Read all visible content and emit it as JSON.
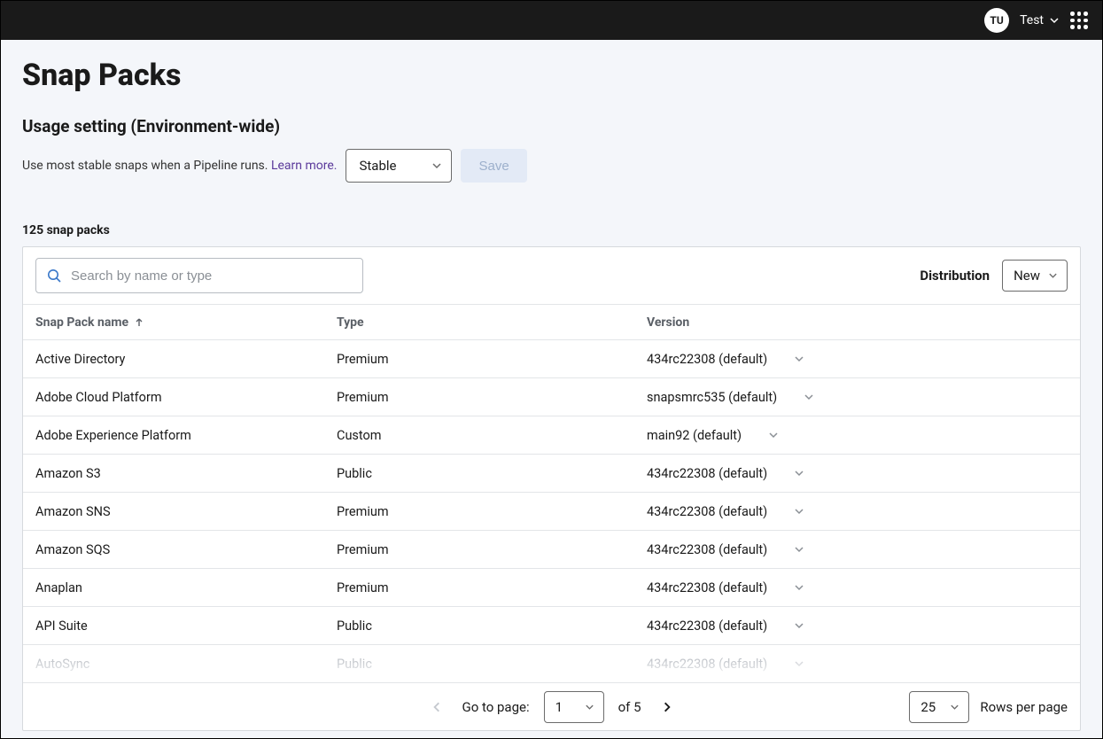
{
  "header": {
    "avatar_initials": "TU",
    "account_label": "Test"
  },
  "page_title": "Snap Packs",
  "usage": {
    "section_title": "Usage setting (Environment-wide)",
    "description": "Use most stable snaps when a Pipeline runs. ",
    "learn_more": "Learn more.",
    "stability_option": "Stable",
    "save_label": "Save"
  },
  "count_label": "125 snap packs",
  "search": {
    "placeholder": "Search by name or type"
  },
  "distribution": {
    "label": "Distribution",
    "selected": "New"
  },
  "columns": {
    "name": "Snap Pack name",
    "type": "Type",
    "version": "Version"
  },
  "rows": [
    {
      "name": "Active Directory",
      "type": "Premium",
      "version": "434rc22308 (default)"
    },
    {
      "name": "Adobe Cloud Platform",
      "type": "Premium",
      "version": "snapsmrc535 (default)"
    },
    {
      "name": "Adobe Experience Platform",
      "type": "Custom",
      "version": "main92 (default)"
    },
    {
      "name": "Amazon S3",
      "type": "Public",
      "version": "434rc22308 (default)"
    },
    {
      "name": "Amazon SNS",
      "type": "Premium",
      "version": "434rc22308 (default)"
    },
    {
      "name": "Amazon SQS",
      "type": "Premium",
      "version": "434rc22308 (default)"
    },
    {
      "name": "Anaplan",
      "type": "Premium",
      "version": "434rc22308 (default)"
    },
    {
      "name": "API Suite",
      "type": "Public",
      "version": "434rc22308 (default)"
    },
    {
      "name": "AutoSync",
      "type": "Public",
      "version": "434rc22308 (default)"
    }
  ],
  "pagination": {
    "go_to_page_label": "Go to page:",
    "current_page": "1",
    "of_label": "of 5",
    "rows_per_page": "25",
    "rows_per_page_label": "Rows per page"
  }
}
